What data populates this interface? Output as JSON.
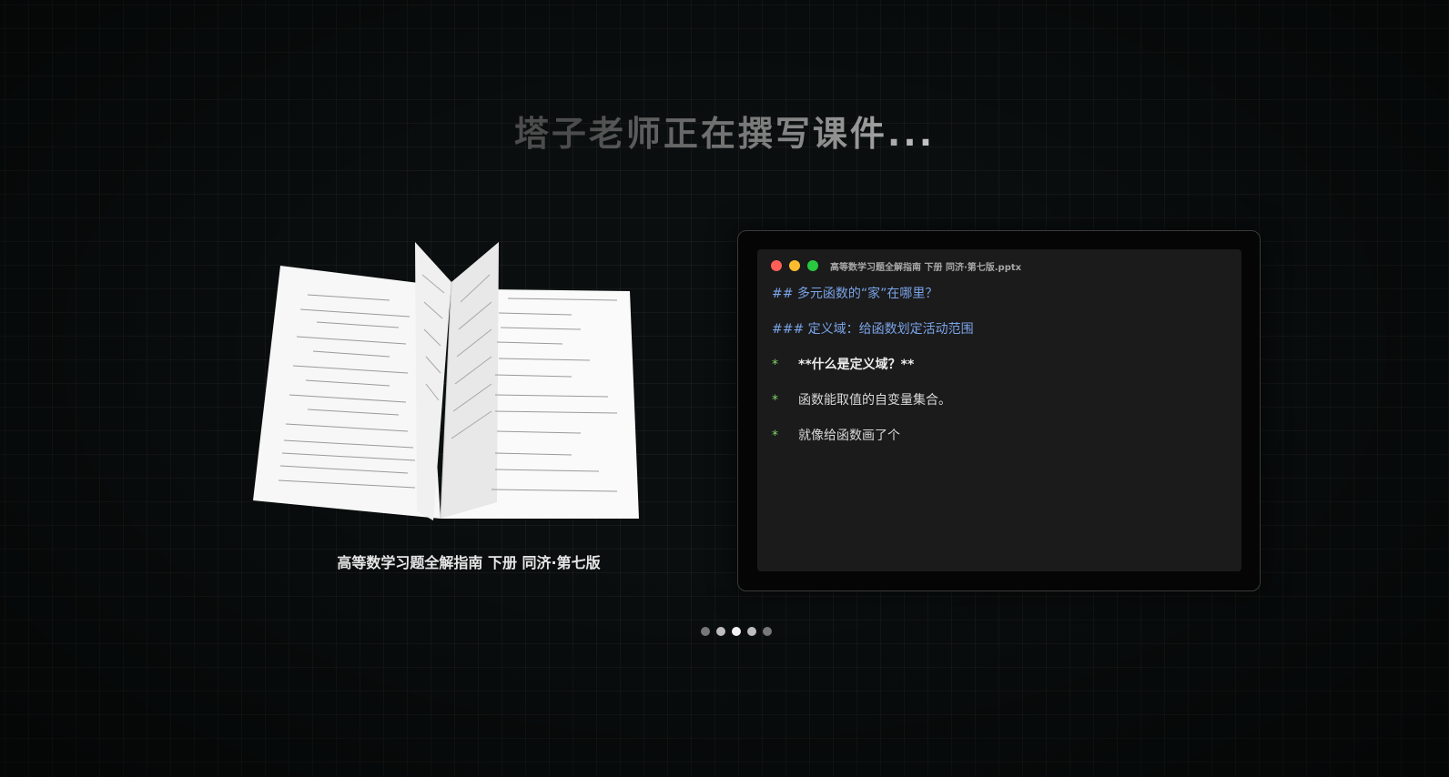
{
  "headline": "塔子老师正在撰写课件...",
  "book": {
    "title": "高等数学习题全解指南 下册 同济·第七版"
  },
  "editor": {
    "file_name": "高等数学习题全解指南 下册 同济·第七版.pptx",
    "window_controls": {
      "close_color": "#ff5f57",
      "minimize_color": "#febc2e",
      "maximize_color": "#28c840"
    },
    "lines": [
      {
        "text": "## 多元函数的“家”在哪里？"
      },
      {
        "text": "### 定义域：给函数划定活动范围"
      },
      {
        "marker": "*",
        "text": "**什么是定义域？**"
      },
      {
        "marker": "*",
        "text": "函数能取值的自变量集合。"
      },
      {
        "marker": "*",
        "text": "就像给函数画了个"
      }
    ]
  },
  "pager": {
    "count": 5,
    "active_index": 2
  },
  "colors": {
    "heading": "#7aa3e8",
    "bullet_marker": "#7fd46a",
    "background": "#0a0e0e"
  }
}
